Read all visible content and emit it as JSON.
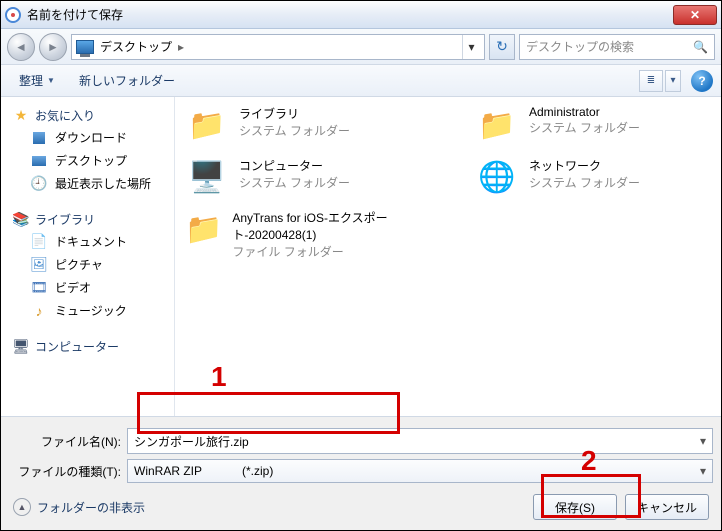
{
  "titlebar": {
    "title": "名前を付けて保存"
  },
  "nav": {
    "breadcrumb_location": "デスクトップ",
    "search_placeholder": "デスクトップの検索"
  },
  "toolbar": {
    "organize": "整理",
    "newfolder": "新しいフォルダー"
  },
  "sidebar": {
    "favorites": {
      "label": "お気に入り",
      "items": [
        "ダウンロード",
        "デスクトップ",
        "最近表示した場所"
      ]
    },
    "libraries": {
      "label": "ライブラリ",
      "items": [
        "ドキュメント",
        "ピクチャ",
        "ビデオ",
        "ミュージック"
      ]
    },
    "computer": {
      "label": "コンピューター"
    }
  },
  "content": {
    "items": [
      {
        "name": "ライブラリ",
        "sub": "システム フォルダー"
      },
      {
        "name": "コンピューター",
        "sub": "システム フォルダー"
      },
      {
        "name": "AnyTrans for iOS-エクスポート-20200428(1)",
        "sub": "ファイル フォルダー"
      },
      {
        "name": "Administrator",
        "sub": "システム フォルダー"
      },
      {
        "name": "ネットワーク",
        "sub": "システム フォルダー"
      }
    ]
  },
  "form": {
    "filename_label": "ファイル名(N):",
    "filename_value": "シンガポール旅行.zip",
    "filetype_label": "ファイルの種類(T):",
    "filetype_value": "WinRAR ZIP            (*.zip)",
    "folder_toggle": "フォルダーの非表示",
    "save_btn": "保存(S)",
    "cancel_btn": "キャンセル"
  },
  "markers": {
    "one": "1",
    "two": "2"
  }
}
